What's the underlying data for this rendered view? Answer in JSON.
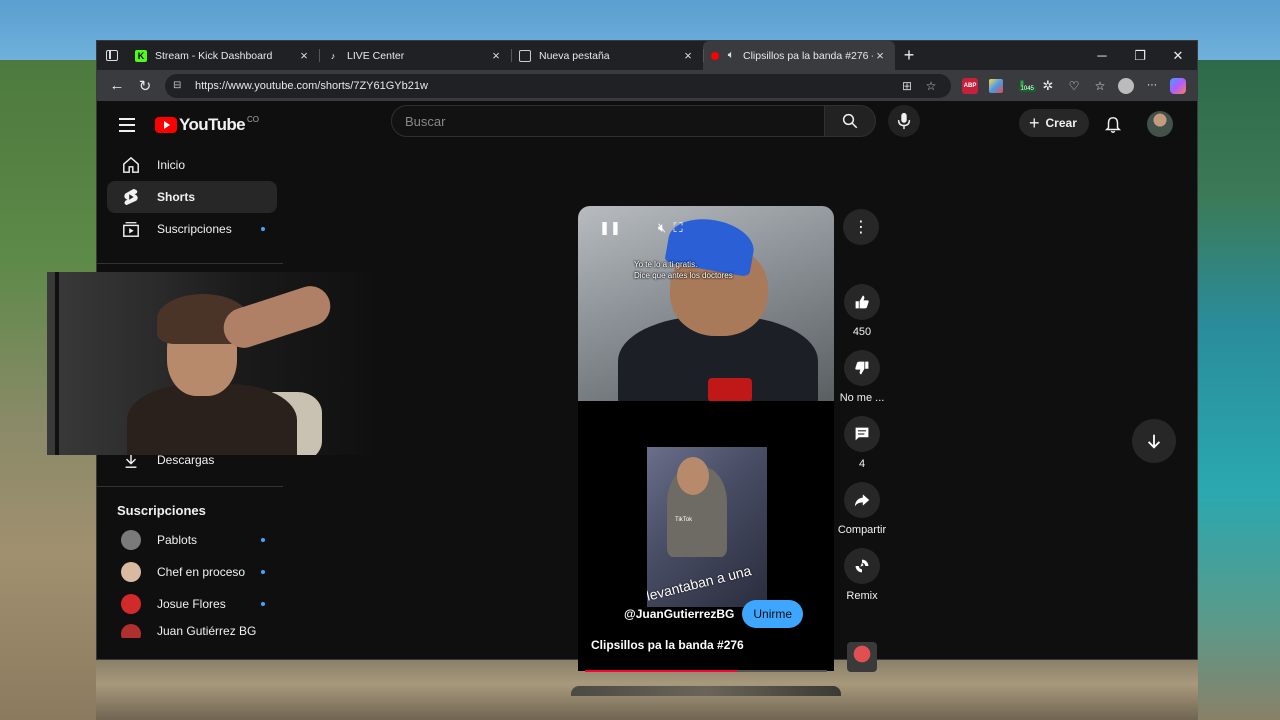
{
  "browser": {
    "tabs": [
      {
        "title": "Stream - Kick Dashboard",
        "icon": "kick-icon",
        "color": "#53fc18"
      },
      {
        "title": "LIVE Center",
        "icon": "tiktok-icon",
        "color": "#ffffff"
      },
      {
        "title": "Nueva pestaña",
        "icon": "new-tab-page-icon",
        "color": "#cccccc"
      },
      {
        "title": "Clipsillos pa la banda #276 -",
        "icon": "youtube-icon",
        "color": "#ff0000",
        "active": true
      }
    ],
    "url": "https://www.youtube.com/shorts/7ZY61GYb21w",
    "extension_badge": "1045"
  },
  "youtube": {
    "logo_text": "YouTube",
    "country_code": "CO",
    "search_placeholder": "Buscar",
    "create_label": "Crear",
    "sidebar": {
      "main": [
        {
          "label": "Inicio",
          "icon": "home-icon"
        },
        {
          "label": "Shorts",
          "icon": "shorts-icon",
          "selected": true
        },
        {
          "label": "Suscripciones",
          "icon": "subscriptions-icon",
          "dot": true
        }
      ],
      "downloads": "Descargas",
      "subs_heading": "Suscripciones",
      "subscriptions": [
        {
          "name": "Pablots",
          "color": "#7a7a7a"
        },
        {
          "name": "Chef en proceso",
          "color": "#d9b9a0"
        },
        {
          "name": "Josue Flores",
          "color": "#d12a2a"
        },
        {
          "name": "Juan Gutiérrez BG",
          "color": "#b03030"
        }
      ]
    },
    "short": {
      "caption_line1": "Yo te lo a ti gratis.",
      "caption_line2": "Dice que antes los doctores",
      "inner_watermark": "TikTok",
      "inner_text": "levantaban a una",
      "channel": "@JuanGutierrezBG",
      "join_label": "Unirme",
      "title": "Clipsillos pa la banda #276",
      "progress": 0.63
    },
    "actions": {
      "likes": "450",
      "dislike_label": "No me ...",
      "comments": "4",
      "share_label": "Compartir",
      "remix_label": "Remix"
    }
  }
}
